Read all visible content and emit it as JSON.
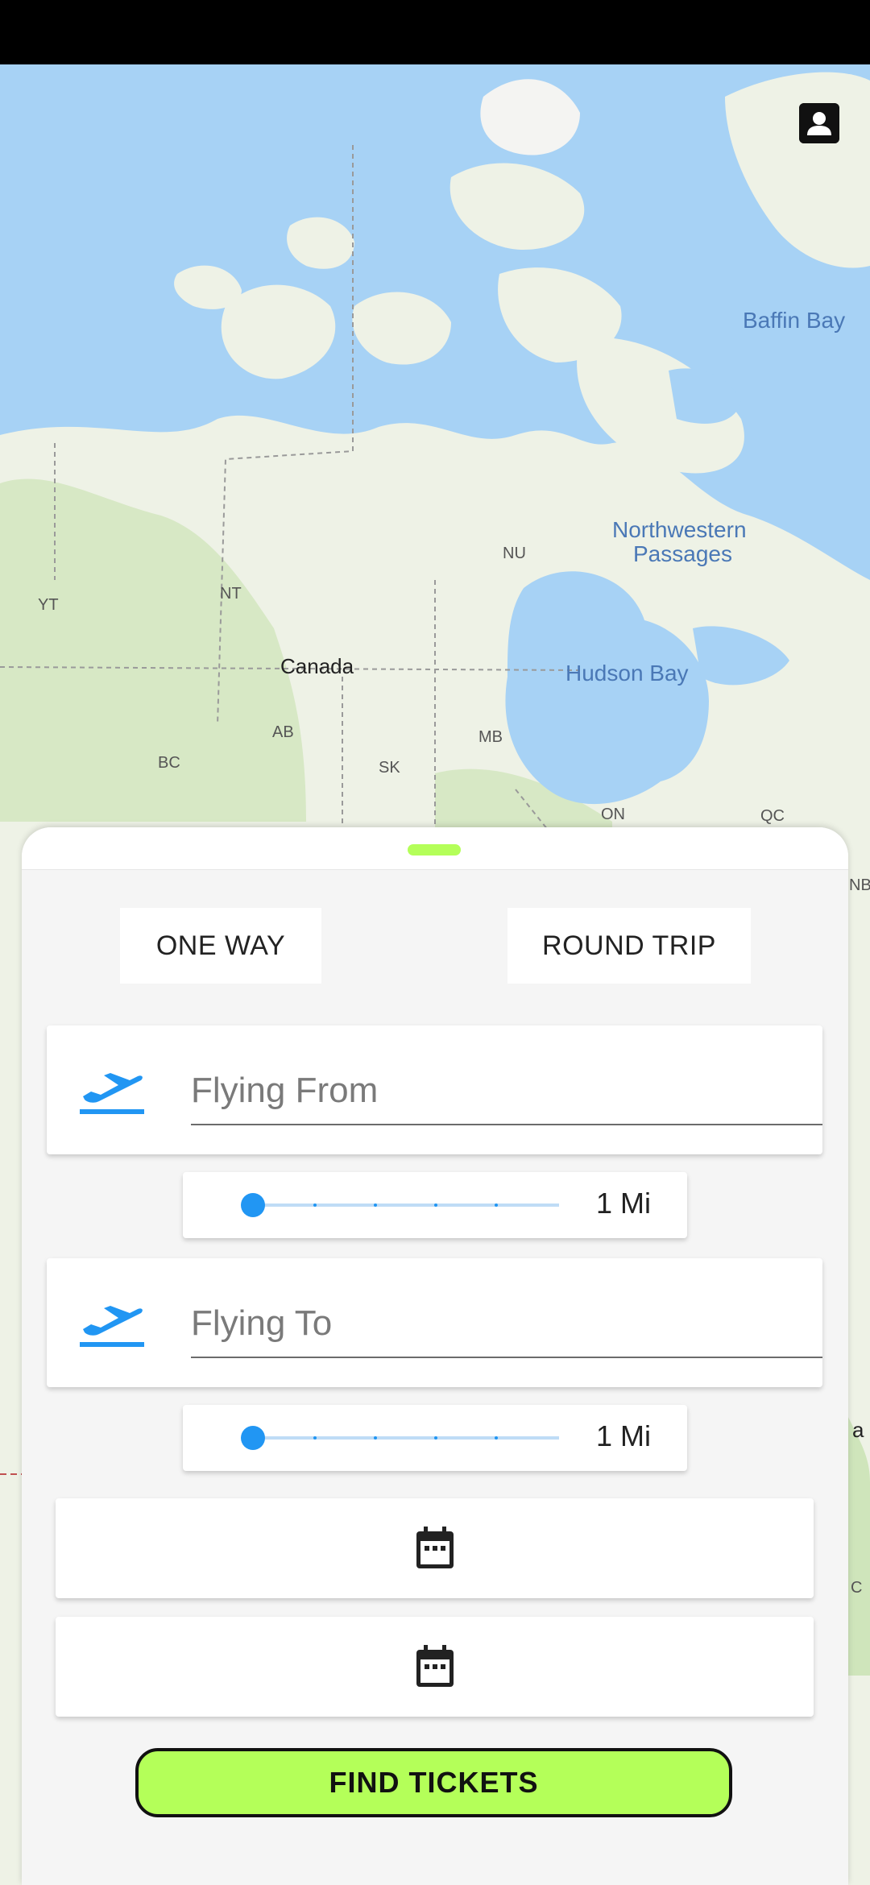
{
  "map": {
    "labels": {
      "baffin_bay": "Baffin Bay",
      "northwestern_passages_1": "Northwestern",
      "northwestern_passages_2": "Passages",
      "hudson_bay": "Hudson Bay",
      "canada": "Canada",
      "nu": "NU",
      "nt": "NT",
      "yt": "YT",
      "ab": "AB",
      "bc": "BC",
      "sk": "SK",
      "mb": "MB",
      "on": "ON",
      "qc": "QC",
      "nb": "NB",
      "edge_a": "a",
      "edge_c": "C"
    }
  },
  "trip_type": {
    "one_way": "ONE WAY",
    "round_trip": "ROUND TRIP"
  },
  "flying_from": {
    "placeholder": "Flying From",
    "icon": "plane-departure-icon"
  },
  "flying_from_radius": {
    "value_label": "1 Mi",
    "level": 0
  },
  "flying_to": {
    "placeholder": "Flying To",
    "icon": "plane-departure-icon"
  },
  "flying_to_radius": {
    "value_label": "1 Mi",
    "level": 0
  },
  "dates": {
    "icon": "calendar-icon"
  },
  "find_button": "FIND TICKETS",
  "colors": {
    "accent_green": "#b4ff59",
    "accent_blue": "#2196f3",
    "water": "#a7d2f5",
    "land": "#eef2e6"
  }
}
